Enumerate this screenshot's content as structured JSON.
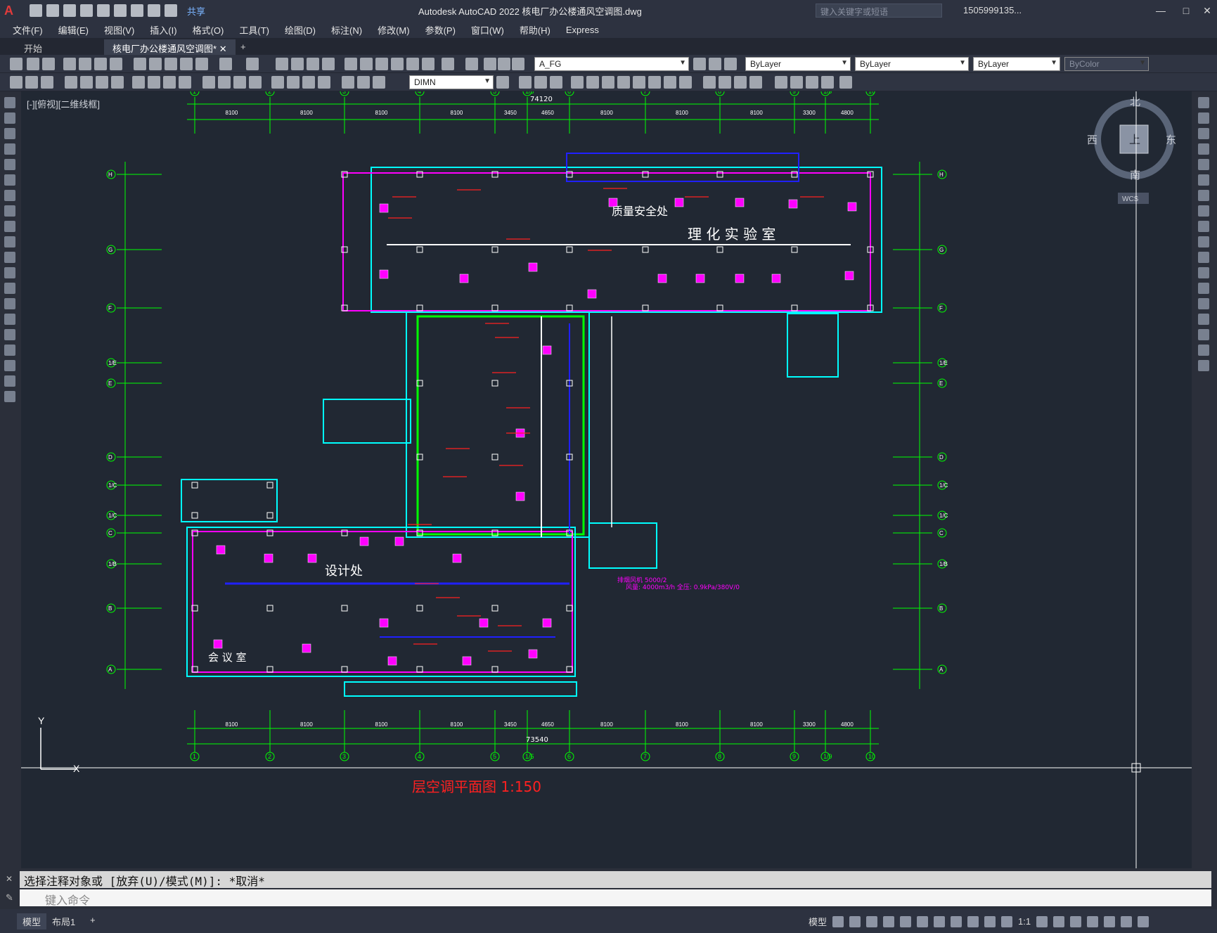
{
  "app": {
    "title": "Autodesk AutoCAD 2022    核电厂办公楼通风空调图.dwg",
    "share_label": "共享",
    "search_placeholder": "键入关键字或短语",
    "user": "1505999135...",
    "logo": "A"
  },
  "menu": [
    "文件(F)",
    "编辑(E)",
    "视图(V)",
    "插入(I)",
    "格式(O)",
    "工具(T)",
    "绘图(D)",
    "标注(N)",
    "修改(M)",
    "参数(P)",
    "窗口(W)",
    "帮助(H)",
    "Express"
  ],
  "tabs": {
    "start": "开始",
    "drawing": "核电厂办公楼通风空调图*"
  },
  "toolbar": {
    "layer": "A_FG",
    "color": "ByLayer",
    "linetype": "ByLayer",
    "lineweight": "ByLayer",
    "plotstyle": "ByColor",
    "dimstyle": "DIMN"
  },
  "viewport": {
    "label": "[-][俯视][二维线框]",
    "compass": {
      "north": "北",
      "south": "南",
      "east": "东",
      "west": "西",
      "top": "上",
      "wcs": "WCS"
    },
    "ucs": {
      "x": "X",
      "y": "Y"
    }
  },
  "drawing": {
    "axes_top": [
      "1",
      "2",
      "3",
      "4",
      "5",
      "1/5",
      "6",
      "7",
      "8",
      "9",
      "1/9",
      "10"
    ],
    "axes_side": [
      "H",
      "G",
      "F",
      "1/E",
      "E",
      "D",
      "1/C",
      "1/C",
      "C",
      "1/B",
      "B",
      "A"
    ],
    "dims_top": [
      "8100",
      "8100",
      "8100",
      "8100",
      "3450",
      "4650",
      "8100",
      "8100",
      "8100",
      "3300",
      "4800"
    ],
    "total_top": "74120",
    "total_bottom": "73540",
    "rooms": [
      "质量安全处",
      "理 化 实 验 室",
      "设计处",
      "会 议 室"
    ],
    "callouts": [
      "排烟风机 5000/2",
      "风量: 4000m3/h 全压: 0.9kPa/380V/0"
    ],
    "plan_title": "层空调平面图 1:150"
  },
  "command": {
    "history": "选择注释对象或 [放弃(U)/模式(M)]: *取消*",
    "input_placeholder": "键入命令"
  },
  "status": {
    "model_tab": "模型",
    "layout_tab": "布局1",
    "model_label": "模型",
    "scale": "1:1"
  },
  "colors": {
    "background": "#212833",
    "axis_green": "#00ff00",
    "wall_magenta": "#ff00ff",
    "wall_cyan": "#00ffff",
    "duct_blue": "#2020ff",
    "duct_red": "#ff2020",
    "line_white": "#ffffff"
  }
}
